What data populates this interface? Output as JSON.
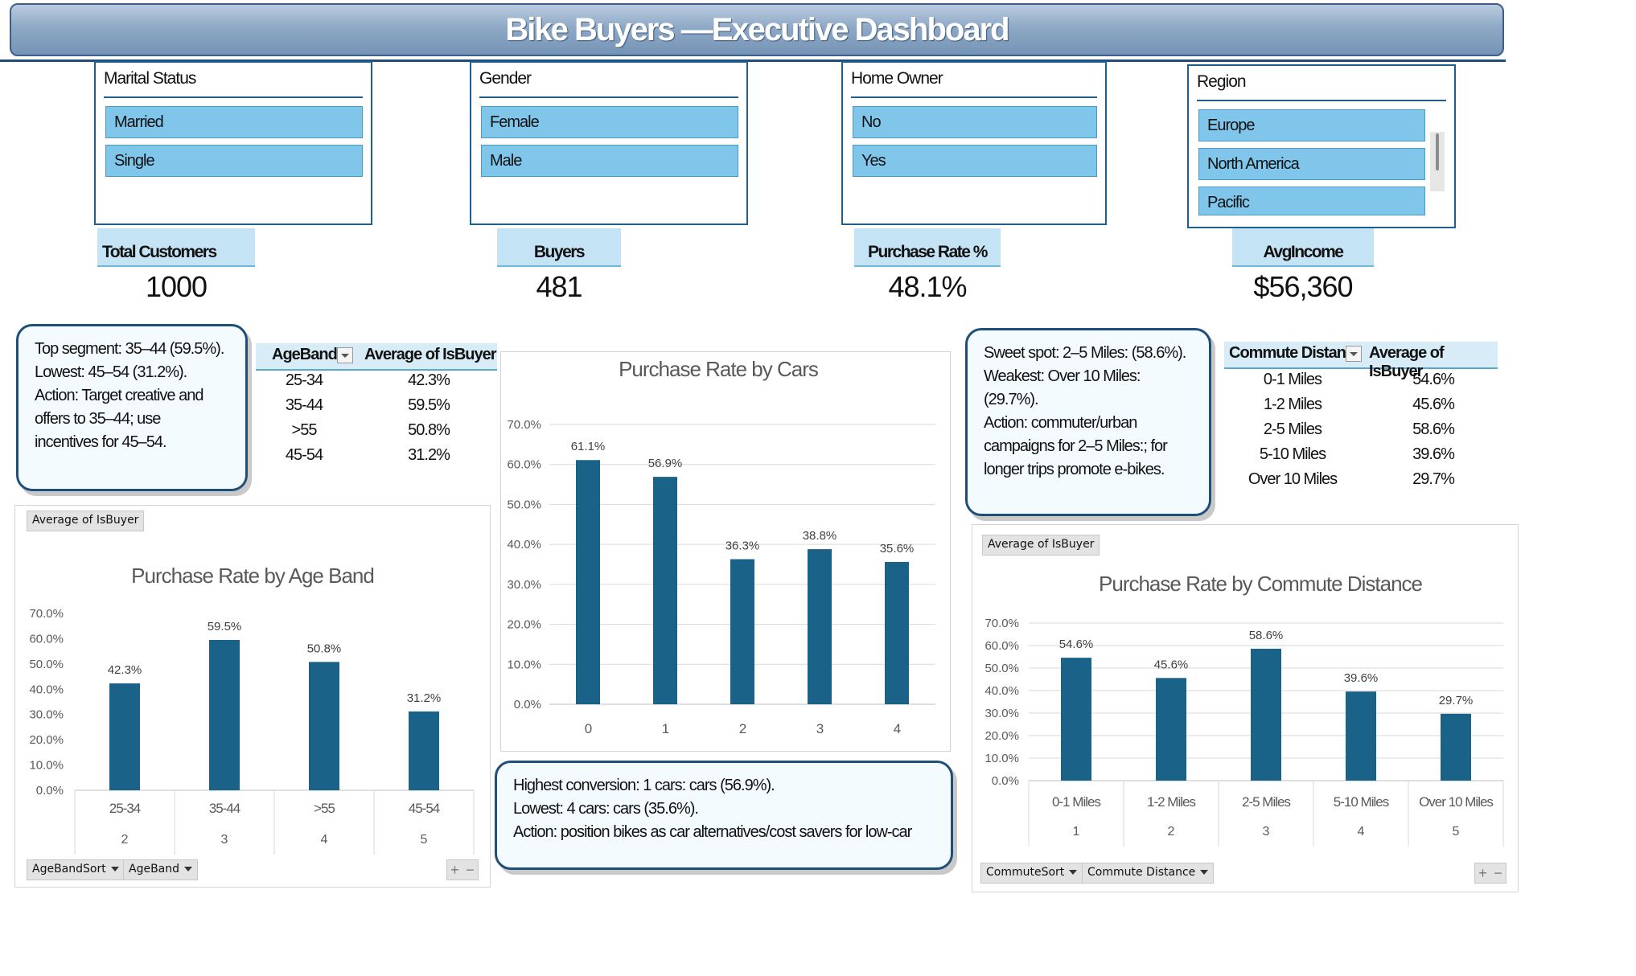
{
  "title": "Bike Buyers —Executive Dashboard",
  "slicers": {
    "marital": {
      "header": "Marital Status",
      "items": [
        "Married",
        "Single"
      ]
    },
    "gender": {
      "header": "Gender",
      "items": [
        "Female",
        "Male"
      ]
    },
    "homeowner": {
      "header": "Home Owner",
      "items": [
        "No",
        "Yes"
      ]
    },
    "region": {
      "header": "Region",
      "items": [
        "Europe",
        "North America",
        "Pacific"
      ]
    }
  },
  "kpis": {
    "total_customers": {
      "label": "Total Customers",
      "value": "1000"
    },
    "buyers": {
      "label": "Buyers",
      "value": "481"
    },
    "purchase_rate": {
      "label": "Purchase Rate %",
      "value": "48.1%"
    },
    "avg_income": {
      "label": "AvgIncome",
      "value": "$56,360"
    }
  },
  "callouts": {
    "age": [
      "Top segment: 35–44 (59.5%).",
      "Lowest: 45–54 (31.2%).",
      "Action: Target creative and",
      "offers to 35–44; use",
      "incentives for 45–54."
    ],
    "commute": [
      "Sweet spot: 2–5 Miles: (58.6%).",
      "Weakest: Over 10 Miles:",
      "(29.7%).",
      "Action: commuter/urban",
      "campaigns for 2–5 Miles:; for",
      "longer trips promote e-bikes."
    ],
    "cars": [
      "Highest conversion: 1 cars: cars (56.9%).",
      "Lowest: 4 cars: cars (35.6%).",
      "Action: position bikes as car alternatives/cost savers for low-car"
    ]
  },
  "pivot_age": {
    "headers": [
      "AgeBand",
      "Average of IsBuyer"
    ],
    "rows": [
      [
        "25-34",
        "42.3%"
      ],
      [
        "35-44",
        "59.5%"
      ],
      [
        ">55",
        "50.8%"
      ],
      [
        "45-54",
        "31.2%"
      ]
    ]
  },
  "pivot_commute": {
    "headers": [
      "Commute Distan",
      "Average of IsBuyer"
    ],
    "rows": [
      [
        "0-1 Miles",
        "54.6%"
      ],
      [
        "1-2 Miles",
        "45.6%"
      ],
      [
        "2-5 Miles",
        "58.6%"
      ],
      [
        "5-10 Miles",
        "39.6%"
      ],
      [
        "Over 10 Miles",
        "29.7%"
      ]
    ]
  },
  "chart_buttons": {
    "age_value": "Average of IsBuyer",
    "age_axis": [
      "AgeBandSort",
      "AgeBand"
    ],
    "commute_value": "Average of IsBuyer",
    "commute_axis": [
      "CommuteSort",
      "Commute Distance"
    ],
    "plus": "+",
    "minus": "−"
  },
  "colors": {
    "bar": "#1a6288",
    "accent": "#1f4e79",
    "slicer_item": "#7fc6ea",
    "kpi_label": "#c4e4f5"
  },
  "chart_data": [
    {
      "type": "bar",
      "title": "Purchase Rate by Age Band",
      "categories": [
        "25-34",
        "35-44",
        ">55",
        "45-54"
      ],
      "sub_categories": [
        "2",
        "3",
        "4",
        "5"
      ],
      "values": [
        42.3,
        59.5,
        50.8,
        31.2
      ],
      "data_labels": [
        "42.3%",
        "59.5%",
        "50.8%",
        "31.2%"
      ],
      "ylim": [
        0,
        70
      ],
      "yticks": [
        "0.0%",
        "10.0%",
        "20.0%",
        "30.0%",
        "40.0%",
        "50.0%",
        "60.0%",
        "70.0%"
      ],
      "grid": false
    },
    {
      "type": "bar",
      "title": "Purchase Rate by Cars",
      "categories": [
        "0",
        "1",
        "2",
        "3",
        "4"
      ],
      "values": [
        61.1,
        56.9,
        36.3,
        38.8,
        35.6
      ],
      "data_labels": [
        "61.1%",
        "56.9%",
        "36.3%",
        "38.8%",
        "35.6%"
      ],
      "ylim": [
        0,
        70
      ],
      "yticks": [
        "0.0%",
        "10.0%",
        "20.0%",
        "30.0%",
        "40.0%",
        "50.0%",
        "60.0%",
        "70.0%"
      ],
      "grid": true
    },
    {
      "type": "bar",
      "title": "Purchase Rate by Commute Distance",
      "categories": [
        "0-1 Miles",
        "1-2 Miles",
        "2-5 Miles",
        "5-10 Miles",
        "Over 10 Miles"
      ],
      "sub_categories": [
        "1",
        "2",
        "3",
        "4",
        "5"
      ],
      "values": [
        54.6,
        45.6,
        58.6,
        39.6,
        29.7
      ],
      "data_labels": [
        "54.6%",
        "45.6%",
        "58.6%",
        "39.6%",
        "29.7%"
      ],
      "ylim": [
        0,
        70
      ],
      "yticks": [
        "0.0%",
        "10.0%",
        "20.0%",
        "30.0%",
        "40.0%",
        "50.0%",
        "60.0%",
        "70.0%"
      ],
      "grid": true
    }
  ]
}
